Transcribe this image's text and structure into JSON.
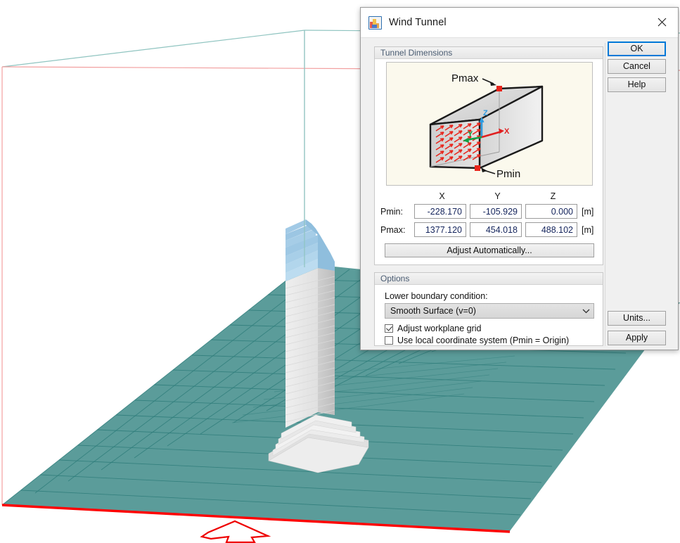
{
  "window": {
    "title": "Wind Tunnel",
    "icon": "wind-tunnel-app-icon",
    "close_icon": "close-icon"
  },
  "groups": {
    "dimensions_title": "Tunnel Dimensions",
    "options_title": "Options"
  },
  "illustration": {
    "label_pmax": "Pmax",
    "label_pmin": "Pmin",
    "axis_x": "X",
    "axis_y": "Y",
    "axis_z": "Z",
    "colors": {
      "background": "#FBF9ED",
      "box_face_light": "#DCDCDC",
      "box_face_mid": "#C9C9C9",
      "box_face_dark": "#B4B4B4",
      "arrow_red": "#E8241B",
      "axis_x": "#E02020",
      "axis_y": "#0FA044",
      "axis_z": "#2F9BE0",
      "marker": "#E8241B"
    }
  },
  "coords": {
    "headers": [
      "X",
      "Y",
      "Z"
    ],
    "unit": "[m]",
    "rows": [
      {
        "label": "Pmin:",
        "x": "-228.170",
        "y": "-105.929",
        "z": "0.000"
      },
      {
        "label": "Pmax:",
        "x": "1377.120",
        "y": "454.018",
        "z": "488.102"
      }
    ],
    "adjust_button": "Adjust Automatically..."
  },
  "options": {
    "boundary_label": "Lower boundary condition:",
    "boundary_value": "Smooth Surface (v=0)",
    "boundary_arrow_icon": "chevron-down-icon",
    "checkbox_adjust_grid": {
      "label": "Adjust workplane grid",
      "checked": true
    },
    "checkbox_local_coords": {
      "label": "Use local coordinate system (Pmin = Origin)",
      "checked": false
    }
  },
  "buttons": {
    "ok": "OK",
    "cancel": "Cancel",
    "help": "Help",
    "units": "Units...",
    "apply": "Apply"
  },
  "viewport": {
    "scene": "3d-building-wind-tunnel-scene",
    "colors": {
      "ground_plane": "#5B9C9A",
      "grid_line": "#2F7D7B",
      "boundary_red": "#FF0000",
      "wire_teal": "#8FC4C0",
      "wire_pink": "#F2A0A0",
      "tower_white": "#F0F0F0",
      "tower_blue": "#A8CFE8",
      "wind_arrow": "#EE0000"
    }
  }
}
